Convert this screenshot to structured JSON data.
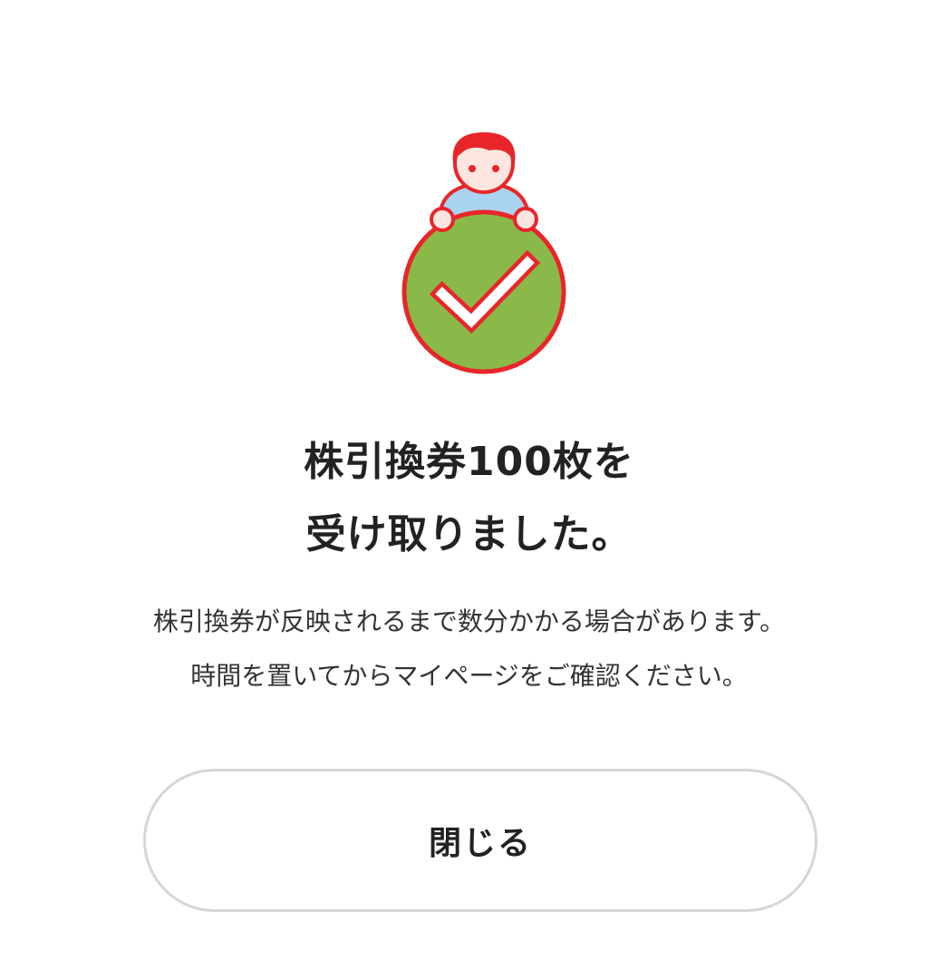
{
  "dialog": {
    "illustration_icon": "person-holding-checkmark-icon",
    "title_line1": "株引換券100枚を",
    "title_line2": "受け取りました。",
    "message_line1": "株引換券が反映されるまで数分かかる場合があります。",
    "message_line2": "時間を置いてからマイページをご確認ください。",
    "close_label": "閉じる"
  },
  "colors": {
    "accent_red": "#e8262a",
    "check_green": "#8ab94a",
    "shirt_blue": "#a9d3ef",
    "skin": "#fde6e0"
  }
}
